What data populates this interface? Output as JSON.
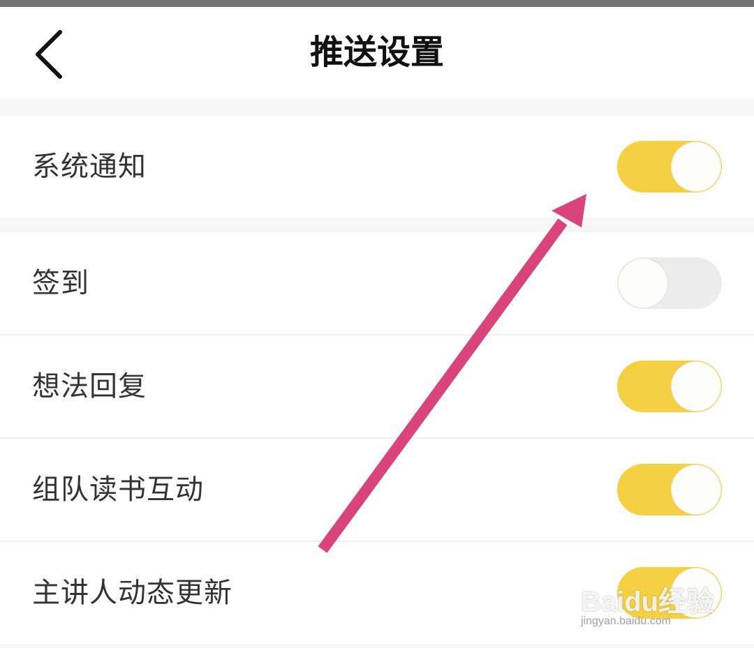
{
  "header": {
    "title": "推送设置",
    "back_icon": "chevron-left-icon"
  },
  "section1": {
    "items": [
      {
        "label": "系统通知",
        "enabled": true
      }
    ]
  },
  "section2": {
    "items": [
      {
        "label": "签到",
        "enabled": false
      },
      {
        "label": "想法回复",
        "enabled": true
      },
      {
        "label": "组队读书互动",
        "enabled": true
      },
      {
        "label": "主讲人动态更新",
        "enabled": true
      }
    ]
  },
  "watermark": {
    "logo": "Baidu经验",
    "url": "jingyan.baidu.com"
  },
  "colors": {
    "toggle_on": "#f6d043",
    "toggle_off": "#ececec",
    "annotation_arrow": "#d9447a"
  }
}
